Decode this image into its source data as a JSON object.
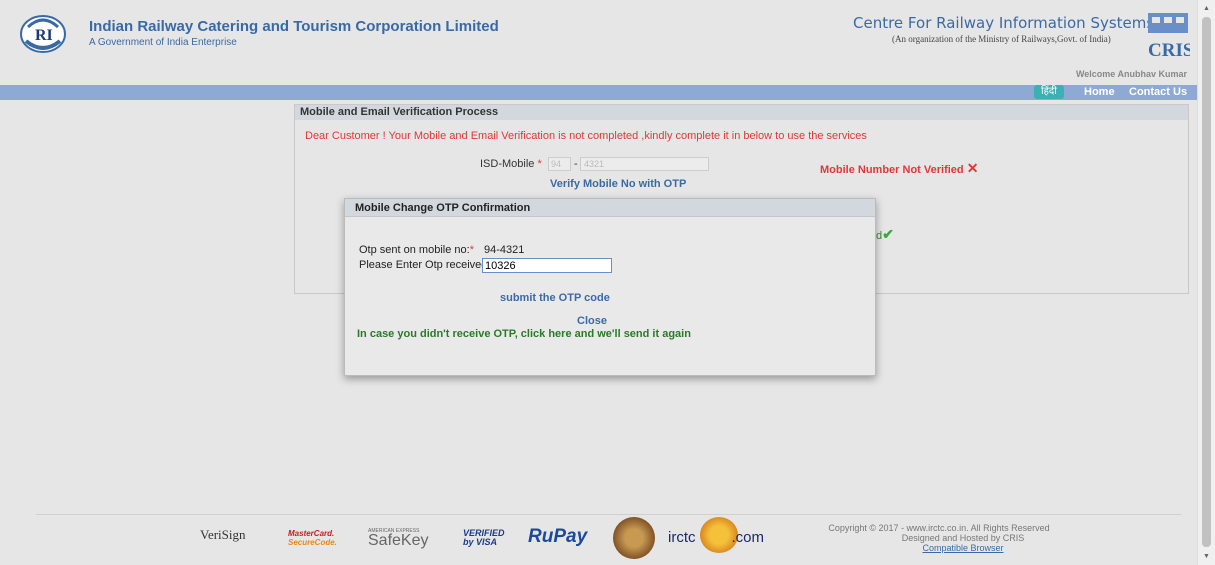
{
  "header": {
    "org_title": "Indian Railway Catering and Tourism Corporation Limited",
    "org_subtitle": "A Government of India Enterprise",
    "cris_title": "Centre For Railway Information Systems",
    "cris_subtitle": "(An organization of the Ministry of Railways,Govt. of India)",
    "cris_logo_text": "CRIS",
    "welcome": "Welcome Anubhav Kumar"
  },
  "nav": {
    "hindi": "हिंदी",
    "home": "Home",
    "contact": "Contact Us"
  },
  "panel": {
    "title": "Mobile and Email Verification Process",
    "notice": "Dear Customer ! Your Mobile and Email Verification is not completed ,kindly complete it in below to use the services",
    "isd_label": "ISD-Mobile",
    "isd_required": "*",
    "isd_code": "94",
    "dash": "-",
    "mobile_number": "4321",
    "verify_mobile_link": "Verify Mobile No with OTP",
    "mobile_status": "Mobile Number Not Verified",
    "email_status_partial": "ified"
  },
  "modal": {
    "title": "Mobile Change OTP Confirmation",
    "otp_sent_label": "Otp sent on mobile no:",
    "otp_sent_value": "94-4321",
    "otp_enter_label": "Please Enter Otp received :",
    "required_mark": "*",
    "otp_value": "10326",
    "submit_label": "submit the OTP code",
    "close_label": "Close",
    "resend_label": "In case you didn't receive OTP, click here and we'll send it again"
  },
  "footer": {
    "verisign": "VeriSign",
    "mastercard_1": "MasterCard.",
    "mastercard_2": "SecureCode.",
    "amex": "AMERICAN EXPRESS",
    "safekey": "SafeKey",
    "vbv_1": "VERIFIED",
    "vbv_2": "by VISA",
    "rupay": "RuPay",
    "irctc_a": "irctc",
    "irctc_b": ".com",
    "copyright_1": "Copyright © 2017 - www.irctc.co.in. All Rights Reserved",
    "copyright_2": "Designed and Hosted by CRIS",
    "compatible": "Compatible Browser"
  },
  "colors": {
    "brand_blue": "#3a6aa5",
    "nav_blue": "#8ea9d4",
    "error_red": "#e03838",
    "success_green": "#2a7a2a"
  }
}
